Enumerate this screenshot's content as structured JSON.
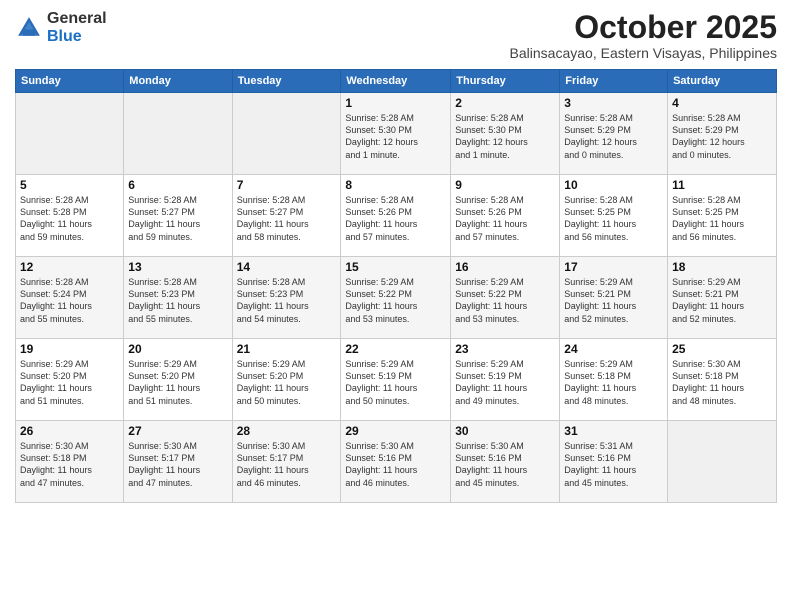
{
  "header": {
    "logo_general": "General",
    "logo_blue": "Blue",
    "month": "October 2025",
    "location": "Balinsacayao, Eastern Visayas, Philippines"
  },
  "days_of_week": [
    "Sunday",
    "Monday",
    "Tuesday",
    "Wednesday",
    "Thursday",
    "Friday",
    "Saturday"
  ],
  "weeks": [
    [
      {
        "day": "",
        "info": ""
      },
      {
        "day": "",
        "info": ""
      },
      {
        "day": "",
        "info": ""
      },
      {
        "day": "1",
        "info": "Sunrise: 5:28 AM\nSunset: 5:30 PM\nDaylight: 12 hours\nand 1 minute."
      },
      {
        "day": "2",
        "info": "Sunrise: 5:28 AM\nSunset: 5:30 PM\nDaylight: 12 hours\nand 1 minute."
      },
      {
        "day": "3",
        "info": "Sunrise: 5:28 AM\nSunset: 5:29 PM\nDaylight: 12 hours\nand 0 minutes."
      },
      {
        "day": "4",
        "info": "Sunrise: 5:28 AM\nSunset: 5:29 PM\nDaylight: 12 hours\nand 0 minutes."
      }
    ],
    [
      {
        "day": "5",
        "info": "Sunrise: 5:28 AM\nSunset: 5:28 PM\nDaylight: 11 hours\nand 59 minutes."
      },
      {
        "day": "6",
        "info": "Sunrise: 5:28 AM\nSunset: 5:27 PM\nDaylight: 11 hours\nand 59 minutes."
      },
      {
        "day": "7",
        "info": "Sunrise: 5:28 AM\nSunset: 5:27 PM\nDaylight: 11 hours\nand 58 minutes."
      },
      {
        "day": "8",
        "info": "Sunrise: 5:28 AM\nSunset: 5:26 PM\nDaylight: 11 hours\nand 57 minutes."
      },
      {
        "day": "9",
        "info": "Sunrise: 5:28 AM\nSunset: 5:26 PM\nDaylight: 11 hours\nand 57 minutes."
      },
      {
        "day": "10",
        "info": "Sunrise: 5:28 AM\nSunset: 5:25 PM\nDaylight: 11 hours\nand 56 minutes."
      },
      {
        "day": "11",
        "info": "Sunrise: 5:28 AM\nSunset: 5:25 PM\nDaylight: 11 hours\nand 56 minutes."
      }
    ],
    [
      {
        "day": "12",
        "info": "Sunrise: 5:28 AM\nSunset: 5:24 PM\nDaylight: 11 hours\nand 55 minutes."
      },
      {
        "day": "13",
        "info": "Sunrise: 5:28 AM\nSunset: 5:23 PM\nDaylight: 11 hours\nand 55 minutes."
      },
      {
        "day": "14",
        "info": "Sunrise: 5:28 AM\nSunset: 5:23 PM\nDaylight: 11 hours\nand 54 minutes."
      },
      {
        "day": "15",
        "info": "Sunrise: 5:29 AM\nSunset: 5:22 PM\nDaylight: 11 hours\nand 53 minutes."
      },
      {
        "day": "16",
        "info": "Sunrise: 5:29 AM\nSunset: 5:22 PM\nDaylight: 11 hours\nand 53 minutes."
      },
      {
        "day": "17",
        "info": "Sunrise: 5:29 AM\nSunset: 5:21 PM\nDaylight: 11 hours\nand 52 minutes."
      },
      {
        "day": "18",
        "info": "Sunrise: 5:29 AM\nSunset: 5:21 PM\nDaylight: 11 hours\nand 52 minutes."
      }
    ],
    [
      {
        "day": "19",
        "info": "Sunrise: 5:29 AM\nSunset: 5:20 PM\nDaylight: 11 hours\nand 51 minutes."
      },
      {
        "day": "20",
        "info": "Sunrise: 5:29 AM\nSunset: 5:20 PM\nDaylight: 11 hours\nand 51 minutes."
      },
      {
        "day": "21",
        "info": "Sunrise: 5:29 AM\nSunset: 5:20 PM\nDaylight: 11 hours\nand 50 minutes."
      },
      {
        "day": "22",
        "info": "Sunrise: 5:29 AM\nSunset: 5:19 PM\nDaylight: 11 hours\nand 50 minutes."
      },
      {
        "day": "23",
        "info": "Sunrise: 5:29 AM\nSunset: 5:19 PM\nDaylight: 11 hours\nand 49 minutes."
      },
      {
        "day": "24",
        "info": "Sunrise: 5:29 AM\nSunset: 5:18 PM\nDaylight: 11 hours\nand 48 minutes."
      },
      {
        "day": "25",
        "info": "Sunrise: 5:30 AM\nSunset: 5:18 PM\nDaylight: 11 hours\nand 48 minutes."
      }
    ],
    [
      {
        "day": "26",
        "info": "Sunrise: 5:30 AM\nSunset: 5:18 PM\nDaylight: 11 hours\nand 47 minutes."
      },
      {
        "day": "27",
        "info": "Sunrise: 5:30 AM\nSunset: 5:17 PM\nDaylight: 11 hours\nand 47 minutes."
      },
      {
        "day": "28",
        "info": "Sunrise: 5:30 AM\nSunset: 5:17 PM\nDaylight: 11 hours\nand 46 minutes."
      },
      {
        "day": "29",
        "info": "Sunrise: 5:30 AM\nSunset: 5:16 PM\nDaylight: 11 hours\nand 46 minutes."
      },
      {
        "day": "30",
        "info": "Sunrise: 5:30 AM\nSunset: 5:16 PM\nDaylight: 11 hours\nand 45 minutes."
      },
      {
        "day": "31",
        "info": "Sunrise: 5:31 AM\nSunset: 5:16 PM\nDaylight: 11 hours\nand 45 minutes."
      },
      {
        "day": "",
        "info": ""
      }
    ]
  ]
}
